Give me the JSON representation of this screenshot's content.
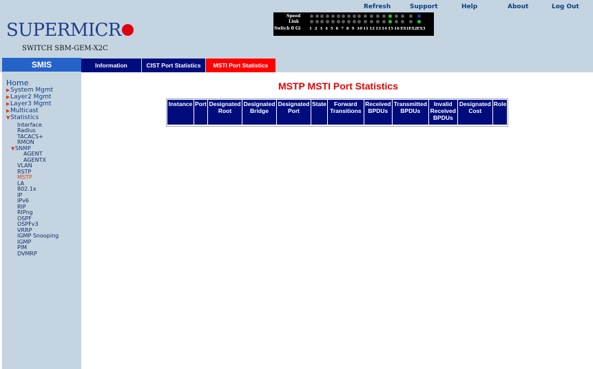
{
  "topnav": {
    "refresh": "Refresh",
    "support": "Support",
    "help": "Help",
    "about": "About",
    "logout": "Log Out"
  },
  "brand": {
    "logo_text": "SUPERMICR",
    "product": "SWITCH SBM-GEM-X2C"
  },
  "port_panel": {
    "speed_label": "Speed",
    "link_label": "Link",
    "switch_label": "Switch 0 Gi",
    "ports": [
      "1",
      "2",
      "3",
      "4",
      "5",
      "6",
      "7",
      "8",
      "9",
      "10",
      "11",
      "12",
      "13",
      "14",
      "15",
      "16",
      "EX1",
      "EX2",
      "EX3"
    ],
    "speed_leds": [
      "off",
      "off",
      "off",
      "off",
      "off",
      "off",
      "off",
      "off",
      "off",
      "off",
      "off",
      "off",
      "off",
      "off",
      "green",
      "off",
      "off",
      "off",
      "blue"
    ],
    "link_leds": [
      "off",
      "off",
      "off",
      "off",
      "off",
      "off",
      "off",
      "off",
      "off",
      "off",
      "off",
      "off",
      "off",
      "off",
      "green",
      "off",
      "off",
      "off",
      "green"
    ]
  },
  "tabs": {
    "smis": "SMIS",
    "items": [
      {
        "label": "Information",
        "active": false
      },
      {
        "label": "CIST Port Statistics",
        "active": false
      },
      {
        "label": "MSTI Port Statistics",
        "active": true
      }
    ]
  },
  "sidebar": {
    "home": "Home",
    "top_items": [
      "System Mgmt",
      "Layer2 Mgmt",
      "Layer3 Mgmt",
      "Multicast",
      "Statistics"
    ],
    "statistics_items": [
      "Interface",
      "Radius",
      "TACACS+",
      "RMON"
    ],
    "snmp": "SNMP",
    "snmp_items": [
      "AGENT",
      "AGENTX"
    ],
    "more_items": [
      "VLAN",
      "RSTP",
      "MSTP",
      "LA",
      "802.1x",
      "IP",
      "IPv6",
      "RIP",
      "RIPng",
      "OSPF",
      "OSPFv3",
      "VRRP",
      "IGMP Snooping",
      "IGMP",
      "PIM",
      "DVMRP"
    ],
    "current": "MSTP"
  },
  "main": {
    "title": "MSTP MSTI Port Statistics",
    "columns": [
      "Instance",
      "Port",
      "Designated Root",
      "Designated Bridge",
      "Designated Port",
      "State",
      "Forward Transitions",
      "Received BPDUs",
      "Transmitted BPDUs",
      "Invalid Received BPDUs",
      "Designated Cost",
      "Role"
    ]
  },
  "colors": {
    "header_bg": "#c5d4e1",
    "tab_bg": "#000c7c",
    "tab_active": "#ff0000",
    "smis_bg": "#2563c8",
    "title_red": "#e60000"
  }
}
